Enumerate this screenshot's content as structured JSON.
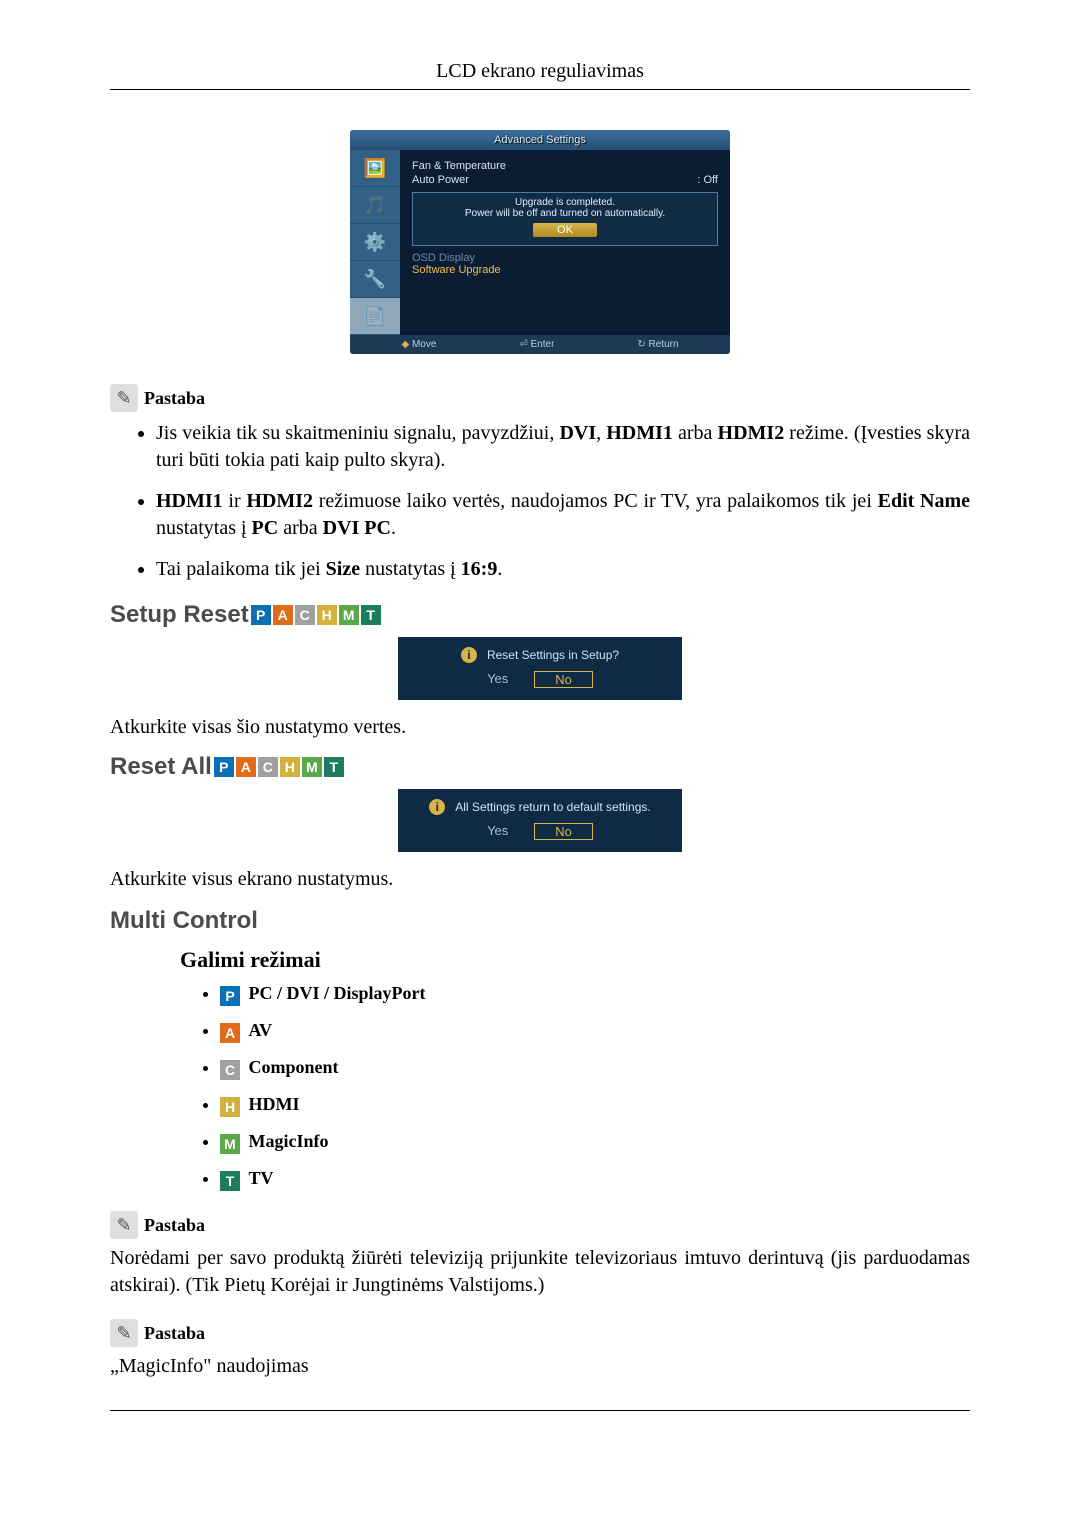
{
  "header": {
    "title": "LCD ekrano reguliavimas"
  },
  "osd": {
    "title": "Advanced Settings",
    "row1": {
      "label": "Fan & Temperature"
    },
    "row2": {
      "label": "Auto Power",
      "value": ": Off"
    },
    "popup": {
      "msg1": "Upgrade is completed.",
      "msg2": "Power will be off and turned on automatically.",
      "ok": "OK"
    },
    "row3": "OSD Display",
    "row4": "Software Upgrade",
    "footer": {
      "move": "Move",
      "enter": "Enter",
      "return": "Return"
    }
  },
  "note1": {
    "label": "Pastaba",
    "b1_pre": "Jis veikia tik su skaitmeniniu signalu, pavyzdžiui, ",
    "b1_dvi": "DVI",
    "b1_c1": ", ",
    "b1_h1": "HDMI1",
    "b1_arba": " arba ",
    "b1_h2": "HDMI2",
    "b1_post": " režime. (Įvesties skyra turi būti tokia pati kaip pulto skyra).",
    "b2_h1": "HDMI1",
    "b2_ir": " ir ",
    "b2_h2": "HDMI2",
    "b2_mid": " režimuose laiko vertės, naudojamos PC ir TV, yra palaikomos tik jei ",
    "b2_en": "Edit Name",
    "b2_set": " nustatytas į ",
    "b2_pc": "PC",
    "b2_arba": " arba ",
    "b2_dvipc": "DVI PC",
    "b2_end": ".",
    "b3_pre": "Tai palaikoma tik jei ",
    "b3_size": "Size",
    "b3_set": " nustatytas į ",
    "b3_169": "16:9",
    "b3_end": "."
  },
  "setup_reset": {
    "title": "Setup Reset",
    "dialog_msg": "Reset Settings in Setup?",
    "yes": "Yes",
    "no": "No",
    "desc": "Atkurkite visas šio nustatymo vertes."
  },
  "reset_all": {
    "title": "Reset All",
    "dialog_msg": "All Settings return to default settings.",
    "yes": "Yes",
    "no": "No",
    "desc": "Atkurkite visus ekrano nustatymus."
  },
  "multi_control": {
    "title": "Multi Control",
    "sub": "Galimi režimai",
    "modes": {
      "p": "PC / DVI / DisplayPort",
      "a": "AV",
      "c": "Component",
      "h": "HDMI",
      "m": "MagicInfo",
      "t": "TV"
    }
  },
  "note2": {
    "label": "Pastaba",
    "text": "Norėdami per savo produktą žiūrėti televiziją prijunkite televizoriaus imtuvo derintuvą (jis parduodamas atskirai). (Tik Pietų Korėjai ir Jungtinėms Valstijoms.)"
  },
  "note3": {
    "label": "Pastaba",
    "text": "„MagicInfo\" naudojimas"
  },
  "badges": {
    "p": "P",
    "a": "A",
    "c": "C",
    "h": "H",
    "m": "M",
    "t": "T"
  }
}
